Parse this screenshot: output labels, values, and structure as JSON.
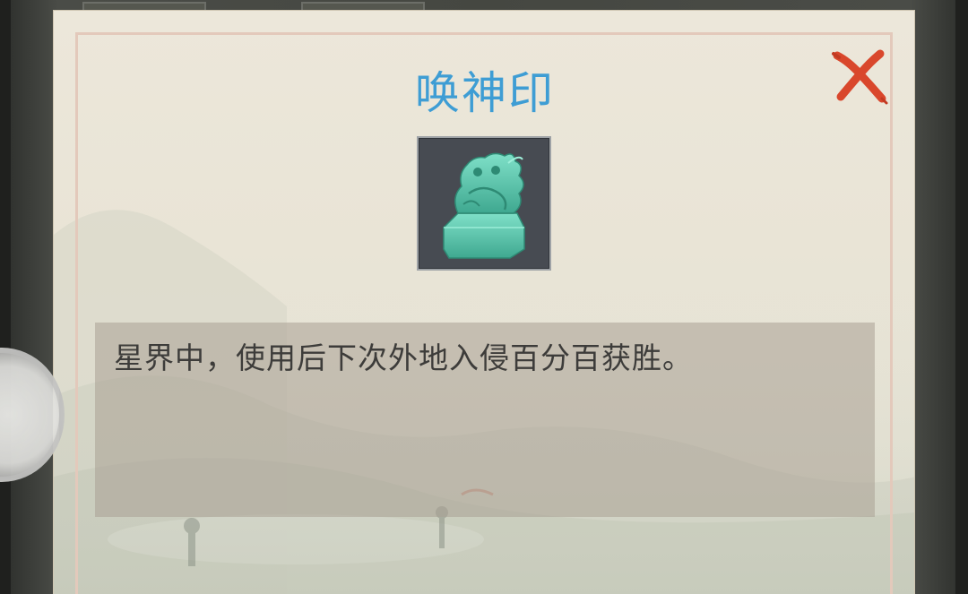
{
  "dialog": {
    "title": "唤神印",
    "description": "星界中，使用后下次外地入侵百分百获胜。",
    "close_icon": "close-x-icon",
    "item_icon": "jade-seal-icon"
  },
  "colors": {
    "title": "#3e9dd4",
    "close": "#d9472c",
    "item_jade": "#5ec9b0",
    "item_bg": "#474b52"
  }
}
